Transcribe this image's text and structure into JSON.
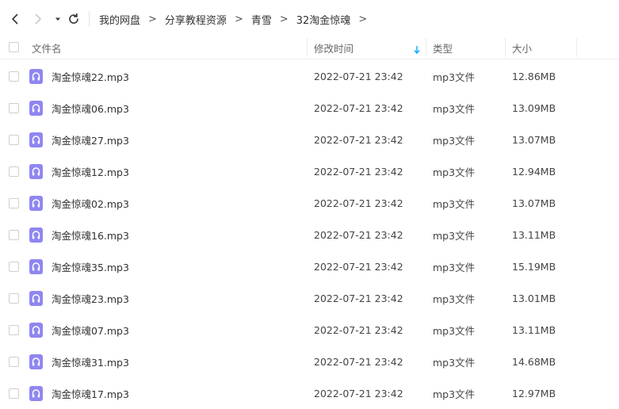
{
  "breadcrumb": [
    "我的网盘",
    "分享教程资源",
    "青雪",
    "32淘金惊魂"
  ],
  "breadcrumb_separator": ">",
  "columns": {
    "name": "文件名",
    "modified": "修改时间",
    "type": "类型",
    "size": "大小"
  },
  "colors": {
    "accent": "#06a7ff",
    "audio_icon": "#8f86f0"
  },
  "files": [
    {
      "name": "淘金惊魂22.mp3",
      "modified": "2022-07-21 23:42",
      "type": "mp3文件",
      "size": "12.86MB"
    },
    {
      "name": "淘金惊魂06.mp3",
      "modified": "2022-07-21 23:42",
      "type": "mp3文件",
      "size": "13.09MB"
    },
    {
      "name": "淘金惊魂27.mp3",
      "modified": "2022-07-21 23:42",
      "type": "mp3文件",
      "size": "13.07MB"
    },
    {
      "name": "淘金惊魂12.mp3",
      "modified": "2022-07-21 23:42",
      "type": "mp3文件",
      "size": "12.94MB"
    },
    {
      "name": "淘金惊魂02.mp3",
      "modified": "2022-07-21 23:42",
      "type": "mp3文件",
      "size": "13.07MB"
    },
    {
      "name": "淘金惊魂16.mp3",
      "modified": "2022-07-21 23:42",
      "type": "mp3文件",
      "size": "13.11MB"
    },
    {
      "name": "淘金惊魂35.mp3",
      "modified": "2022-07-21 23:42",
      "type": "mp3文件",
      "size": "15.19MB"
    },
    {
      "name": "淘金惊魂23.mp3",
      "modified": "2022-07-21 23:42",
      "type": "mp3文件",
      "size": "13.01MB"
    },
    {
      "name": "淘金惊魂07.mp3",
      "modified": "2022-07-21 23:42",
      "type": "mp3文件",
      "size": "13.11MB"
    },
    {
      "name": "淘金惊魂31.mp3",
      "modified": "2022-07-21 23:42",
      "type": "mp3文件",
      "size": "14.68MB"
    },
    {
      "name": "淘金惊魂17.mp3",
      "modified": "2022-07-21 23:42",
      "type": "mp3文件",
      "size": "12.97MB"
    }
  ]
}
